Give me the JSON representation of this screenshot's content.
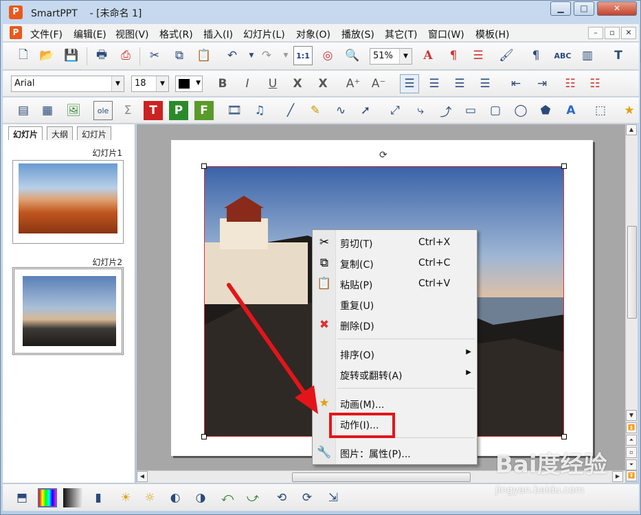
{
  "window": {
    "app_name": "SmartPPT",
    "doc_title": "- [未命名 1]",
    "controls": {
      "minimize": "▁",
      "maximize": "□",
      "close": "✕"
    }
  },
  "menubar": {
    "items": [
      "文件(F)",
      "编辑(E)",
      "视图(V)",
      "格式(R)",
      "插入(I)",
      "幻灯片(L)",
      "对象(O)",
      "播放(S)",
      "其它(T)",
      "窗口(W)",
      "模板(H)"
    ],
    "mdi_controls": [
      "–",
      "▫",
      "✕"
    ]
  },
  "toolbar_main": {
    "zoom": "51%"
  },
  "toolbar_format": {
    "font": "Arial",
    "size": "18",
    "color": "#000000"
  },
  "left_panel": {
    "tabs": [
      "幻灯片",
      "大纲",
      "幻灯片"
    ],
    "slides": [
      {
        "label": "幻灯片1"
      },
      {
        "label": "幻灯片2"
      }
    ]
  },
  "context_menu": {
    "items": [
      {
        "label": "剪切(T)",
        "shortcut": "Ctrl+X",
        "icon": "scissors-icon"
      },
      {
        "label": "复制(C)",
        "shortcut": "Ctrl+C",
        "icon": "copy-icon"
      },
      {
        "label": "粘贴(P)",
        "shortcut": "Ctrl+V",
        "icon": "paste-icon"
      },
      {
        "label": "重复(U)",
        "shortcut": "",
        "icon": ""
      },
      {
        "label": "删除(D)",
        "shortcut": "",
        "icon": "delete-icon"
      },
      {
        "label": "排序(O)",
        "shortcut": "",
        "icon": "",
        "submenu": "▶"
      },
      {
        "label": "旋转或翻转(A)",
        "shortcut": "",
        "icon": "",
        "submenu": "▶"
      },
      {
        "label": "动画(M)...",
        "shortcut": "",
        "icon": "star-icon"
      },
      {
        "label": "动作(I)...",
        "shortcut": "",
        "icon": ""
      },
      {
        "label": "图片：属性(P)...",
        "shortcut": "",
        "icon": "wrench-icon"
      }
    ]
  },
  "watermark": {
    "brand": "Bai度经验",
    "url": "jingyan.baidu.com"
  },
  "colors": {
    "highlight": "#e3151a",
    "selection_border": "#cc3333"
  }
}
